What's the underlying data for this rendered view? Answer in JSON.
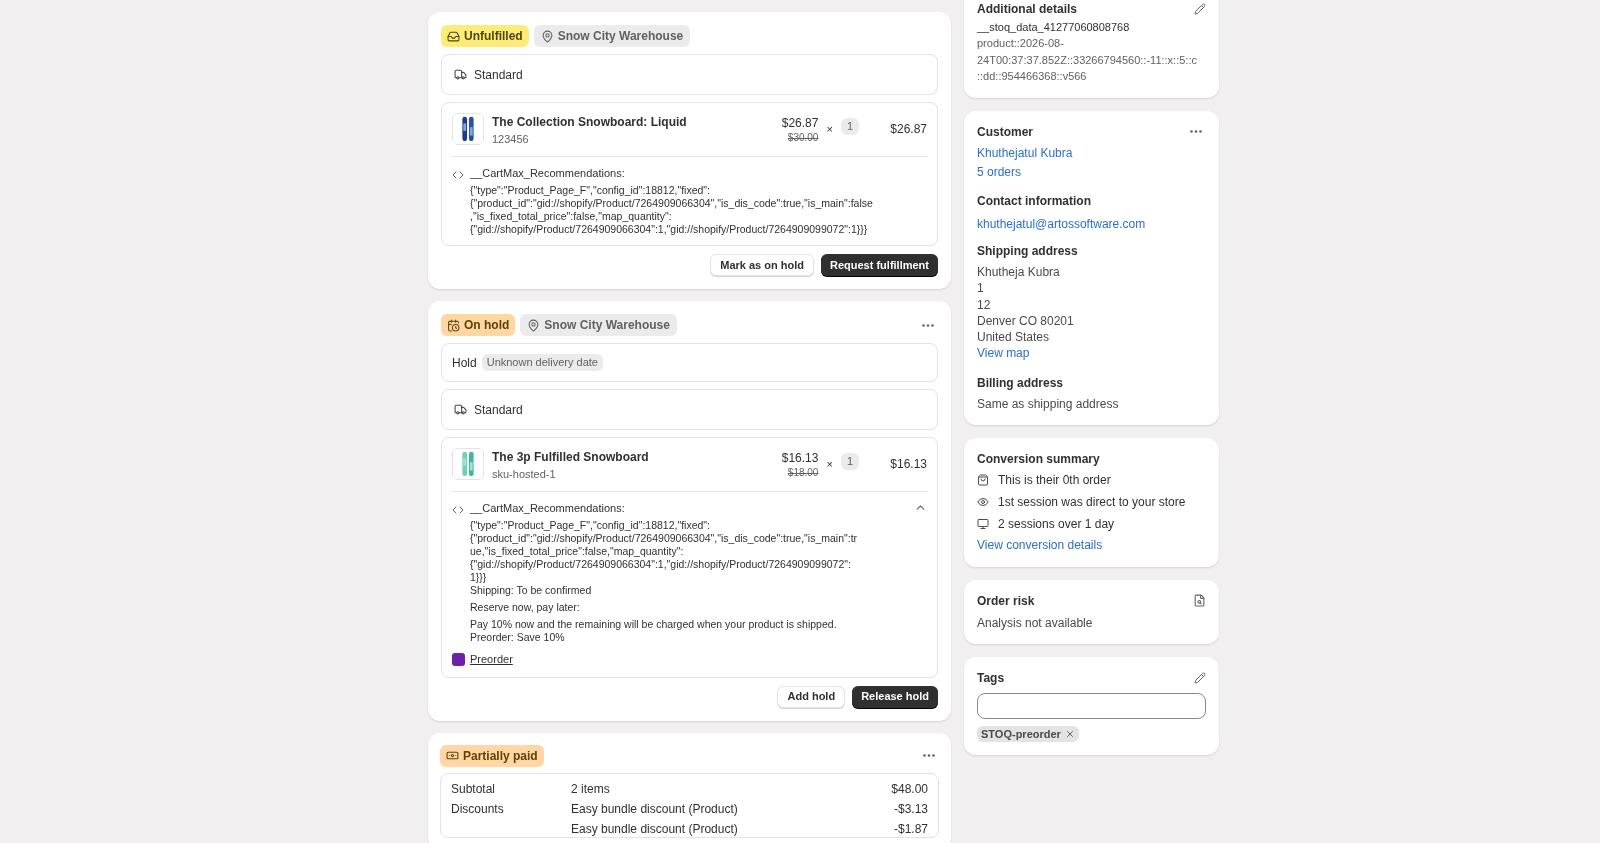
{
  "fulfillments": [
    {
      "status": {
        "kind": "unfulfilled",
        "label": "Unfulfilled"
      },
      "location": "Snow City Warehouse",
      "menu": false,
      "delivery": "Standard",
      "item": {
        "title": "The Collection Snowboard: Liquid",
        "sku": "123456",
        "price": "$26.87",
        "compare_price": "$30.00",
        "times": "×",
        "qty": "1",
        "total": "$26.87"
      },
      "property": {
        "key": "__CartMax_Recommendations:",
        "collapsible": false,
        "lines": [
          "{\"type\":\"Product_Page_F\",\"config_id\":18812,\"fixed\":",
          "{\"product_id\":\"gid://shopify/Product/7264909066304\",\"is_dis_code\":true,\"is_main\":false",
          ",\"is_fixed_total_price\":false,\"map_quantity\":",
          "{\"gid://shopify/Product/7264909066304\":1,\"gid://shopify/Product/7264909099072\":1}}}"
        ]
      },
      "buttons": [
        {
          "label": "Mark as on hold",
          "primary": false
        },
        {
          "label": "Request fulfillment",
          "primary": true
        }
      ]
    },
    {
      "status": {
        "kind": "on_hold",
        "label": "On hold"
      },
      "location": "Snow City Warehouse",
      "menu": true,
      "hold": {
        "label": "Hold",
        "badge": "Unknown delivery date"
      },
      "delivery": "Standard",
      "item": {
        "title": "The 3p Fulfilled Snowboard",
        "sku": "sku-hosted-1",
        "price": "$16.13",
        "compare_price": "$18.00",
        "times": "×",
        "qty": "1",
        "total": "$16.13"
      },
      "property": {
        "key": "__CartMax_Recommendations:",
        "collapsible": true,
        "lines": [
          "{\"type\":\"Product_Page_F\",\"config_id\":18812,\"fixed\":",
          "{\"product_id\":\"gid://shopify/Product/7264909066304\",\"is_dis_code\":true,\"is_main\":tr",
          "ue,\"is_fixed_total_price\":false,\"map_quantity\":",
          "{\"gid://shopify/Product/7264909066304\":1,\"gid://shopify/Product/7264909099072\":",
          "1}}}",
          "Shipping: To be confirmed"
        ],
        "notes": [
          [
            "Reserve now, pay later:"
          ],
          [
            "Pay 10% now and the remaining will be charged when your product is shipped.",
            "Preorder: Save 10%"
          ]
        ]
      },
      "app_link": "Preorder",
      "buttons": [
        {
          "label": "Add hold",
          "primary": false
        },
        {
          "label": "Release hold",
          "primary": true
        }
      ]
    }
  ],
  "payment": {
    "status": {
      "kind": "partially_paid",
      "label": "Partially paid"
    },
    "menu": true,
    "rows": [
      {
        "label": "Subtotal",
        "description": "2 items",
        "amount": "$48.00"
      },
      {
        "label": "Discounts",
        "description": "Easy bundle discount (Product)",
        "amount": "-$3.13"
      },
      {
        "description": "Easy bundle discount (Product)",
        "amount": "-$1.87"
      }
    ]
  },
  "additional_details": {
    "title": "Additional details",
    "key": "__stoq_data_41277060808768",
    "value_lines": [
      "product::2026-08-",
      "24T00:37:37.852Z::33266794560::-11::x::5::c",
      "::dd::954466368::v566"
    ]
  },
  "customer": {
    "title": "Customer",
    "name": "Khuthejatul Kubra",
    "orders": "5 orders",
    "contact_title": "Contact information",
    "email": "khuthejatul@artossoftware.com",
    "shipping_title": "Shipping address",
    "address": [
      "Khutheja Kubra",
      "1",
      "12",
      "Denver CO 80201",
      "United States"
    ],
    "map_link": "View map",
    "billing_title": "Billing address",
    "billing": "Same as shipping address"
  },
  "conversion": {
    "title": "Conversion summary",
    "items": [
      {
        "kind": "order",
        "text": "This is their 0th order"
      },
      {
        "kind": "session",
        "text": "1st session was direct to your store"
      },
      {
        "kind": "sessions",
        "text": "2 sessions over 1 day"
      }
    ],
    "link": "View conversion details"
  },
  "order_risk": {
    "title": "Order risk",
    "text": "Analysis not available"
  },
  "tags": {
    "title": "Tags",
    "items": [
      "STOQ-preorder"
    ]
  }
}
